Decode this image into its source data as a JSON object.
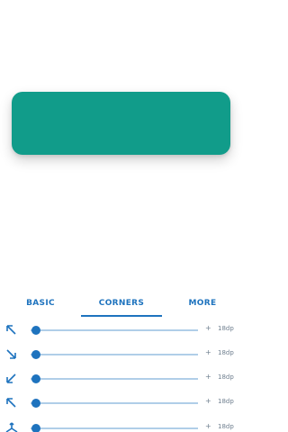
{
  "colors": {
    "card": "#119c8a",
    "accent": "#1e73be",
    "track": "#b8cfe8",
    "text_muted": "#6f7f8f"
  },
  "tabs": [
    {
      "label": "BASIC"
    },
    {
      "label": "CORNERS"
    },
    {
      "label": "MORE"
    }
  ],
  "sliders": [
    {
      "icon": "arrow-top-left-icon",
      "plus": "+",
      "value": "18dp",
      "fraction": 0.03
    },
    {
      "icon": "arrow-bottom-right-icon",
      "plus": "+",
      "value": "18dp",
      "fraction": 0.03
    },
    {
      "icon": "arrow-bottom-left-icon",
      "plus": "+",
      "value": "18dp",
      "fraction": 0.03
    },
    {
      "icon": "arrow-top-left-outward-icon",
      "plus": "+",
      "value": "18dp",
      "fraction": 0.03
    },
    {
      "icon": "all-corners-icon",
      "plus": "+",
      "value": "18dp",
      "fraction": 0.03
    }
  ]
}
